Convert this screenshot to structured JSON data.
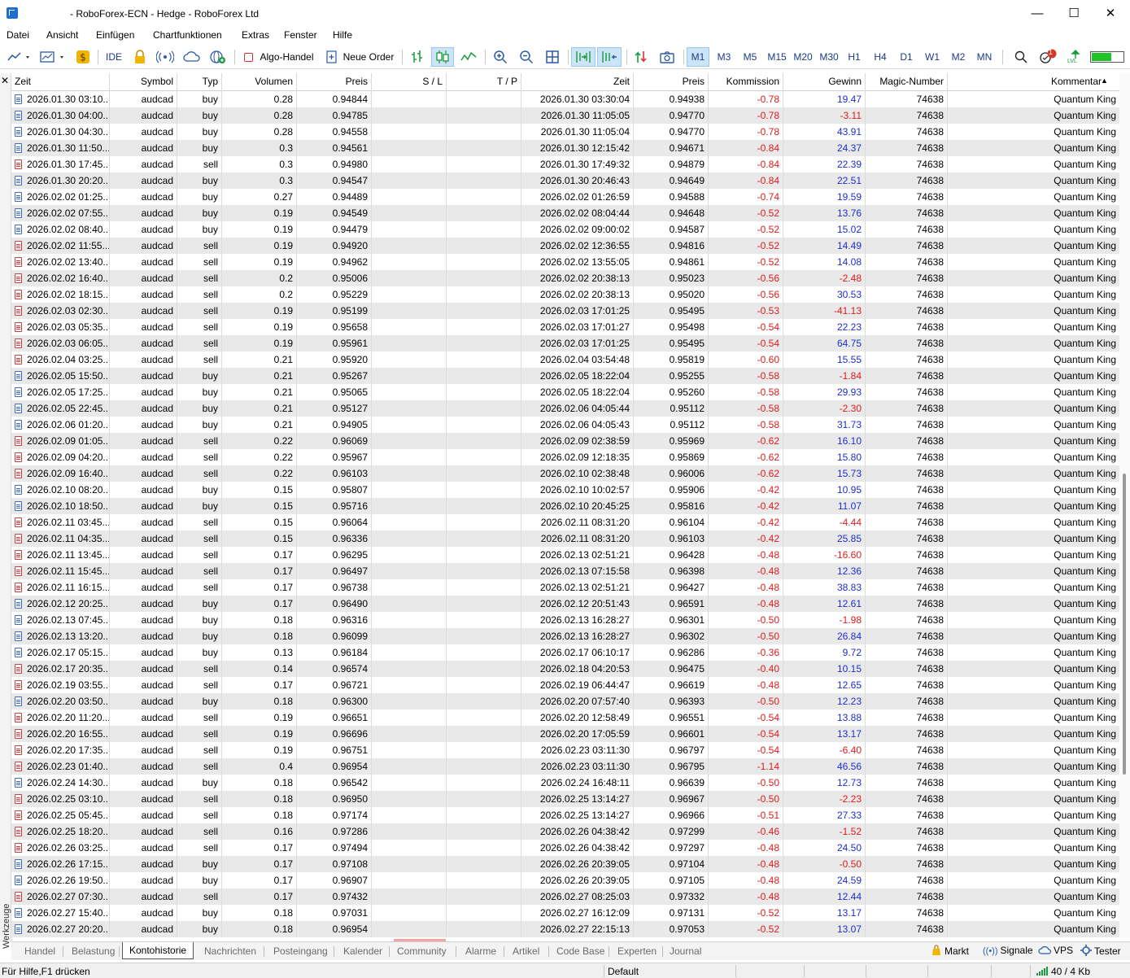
{
  "window": {
    "title": "- RoboForex-ECN - Hedge - RoboForex Ltd",
    "minimize": "—",
    "maximize": "☐",
    "close": "✕"
  },
  "menu": [
    "Datei",
    "Ansicht",
    "Einfügen",
    "Chartfunktionen",
    "Extras",
    "Fenster",
    "Hilfe"
  ],
  "toolbar": {
    "ide": "IDE",
    "algo": "Algo-Handel",
    "neue_order": "Neue Order",
    "timeframes": [
      "M1",
      "M3",
      "M5",
      "M15",
      "M20",
      "M30",
      "H1",
      "H4",
      "D1",
      "W1",
      "M2",
      "MN"
    ],
    "active_timeframe": "M1",
    "notifications": "1",
    "signal_label": "LVL"
  },
  "table": {
    "headers": {
      "zeit": "Zeit",
      "symbol": "Symbol",
      "typ": "Typ",
      "volumen": "Volumen",
      "preis": "Preis",
      "sl": "S / L",
      "tp": "T / P",
      "zeit2": "Zeit",
      "preis2": "Preis",
      "kommission": "Kommission",
      "gewinn": "Gewinn",
      "magic": "Magic-Number",
      "kommentar": "Kommentar"
    },
    "sort_indicator": "▲",
    "rows": [
      [
        "2026.01.30 03:10...",
        "audcad",
        "buy",
        "0.28",
        "0.94844",
        "",
        "",
        "2026.01.30 03:30:04",
        "0.94938",
        "-0.78",
        "19.47",
        "74638",
        "Quantum King"
      ],
      [
        "2026.01.30 04:00...",
        "audcad",
        "buy",
        "0.28",
        "0.94785",
        "",
        "",
        "2026.01.30 11:05:05",
        "0.94770",
        "-0.78",
        "-3.11",
        "74638",
        "Quantum King"
      ],
      [
        "2026.01.30 04:30...",
        "audcad",
        "buy",
        "0.28",
        "0.94558",
        "",
        "",
        "2026.01.30 11:05:04",
        "0.94770",
        "-0.78",
        "43.91",
        "74638",
        "Quantum King"
      ],
      [
        "2026.01.30 11:50...",
        "audcad",
        "buy",
        "0.3",
        "0.94561",
        "",
        "",
        "2026.01.30 12:15:42",
        "0.94671",
        "-0.84",
        "24.37",
        "74638",
        "Quantum King"
      ],
      [
        "2026.01.30 17:45...",
        "audcad",
        "sell",
        "0.3",
        "0.94980",
        "",
        "",
        "2026.01.30 17:49:32",
        "0.94879",
        "-0.84",
        "22.39",
        "74638",
        "Quantum King"
      ],
      [
        "2026.01.30 20:20...",
        "audcad",
        "buy",
        "0.3",
        "0.94547",
        "",
        "",
        "2026.01.30 20:46:43",
        "0.94649",
        "-0.84",
        "22.51",
        "74638",
        "Quantum King"
      ],
      [
        "2026.02.02 01:25...",
        "audcad",
        "buy",
        "0.27",
        "0.94489",
        "",
        "",
        "2026.02.02 01:26:59",
        "0.94588",
        "-0.74",
        "19.59",
        "74638",
        "Quantum King"
      ],
      [
        "2026.02.02 07:55...",
        "audcad",
        "buy",
        "0.19",
        "0.94549",
        "",
        "",
        "2026.02.02 08:04:44",
        "0.94648",
        "-0.52",
        "13.76",
        "74638",
        "Quantum King"
      ],
      [
        "2026.02.02 08:40...",
        "audcad",
        "buy",
        "0.19",
        "0.94479",
        "",
        "",
        "2026.02.02 09:00:02",
        "0.94587",
        "-0.52",
        "15.02",
        "74638",
        "Quantum King"
      ],
      [
        "2026.02.02 11:55...",
        "audcad",
        "sell",
        "0.19",
        "0.94920",
        "",
        "",
        "2026.02.02 12:36:55",
        "0.94816",
        "-0.52",
        "14.49",
        "74638",
        "Quantum King"
      ],
      [
        "2026.02.02 13:40...",
        "audcad",
        "sell",
        "0.19",
        "0.94962",
        "",
        "",
        "2026.02.02 13:55:05",
        "0.94861",
        "-0.52",
        "14.08",
        "74638",
        "Quantum King"
      ],
      [
        "2026.02.02 16:40...",
        "audcad",
        "sell",
        "0.2",
        "0.95006",
        "",
        "",
        "2026.02.02 20:38:13",
        "0.95023",
        "-0.56",
        "-2.48",
        "74638",
        "Quantum King"
      ],
      [
        "2026.02.02 18:15...",
        "audcad",
        "sell",
        "0.2",
        "0.95229",
        "",
        "",
        "2026.02.02 20:38:13",
        "0.95020",
        "-0.56",
        "30.53",
        "74638",
        "Quantum King"
      ],
      [
        "2026.02.03 02:30...",
        "audcad",
        "sell",
        "0.19",
        "0.95199",
        "",
        "",
        "2026.02.03 17:01:25",
        "0.95495",
        "-0.53",
        "-41.13",
        "74638",
        "Quantum King"
      ],
      [
        "2026.02.03 05:35...",
        "audcad",
        "sell",
        "0.19",
        "0.95658",
        "",
        "",
        "2026.02.03 17:01:27",
        "0.95498",
        "-0.54",
        "22.23",
        "74638",
        "Quantum King"
      ],
      [
        "2026.02.03 06:05...",
        "audcad",
        "sell",
        "0.19",
        "0.95961",
        "",
        "",
        "2026.02.03 17:01:25",
        "0.95495",
        "-0.54",
        "64.75",
        "74638",
        "Quantum King"
      ],
      [
        "2026.02.04 03:25...",
        "audcad",
        "sell",
        "0.21",
        "0.95920",
        "",
        "",
        "2026.02.04 03:54:48",
        "0.95819",
        "-0.60",
        "15.55",
        "74638",
        "Quantum King"
      ],
      [
        "2026.02.05 15:50...",
        "audcad",
        "buy",
        "0.21",
        "0.95267",
        "",
        "",
        "2026.02.05 18:22:04",
        "0.95255",
        "-0.58",
        "-1.84",
        "74638",
        "Quantum King"
      ],
      [
        "2026.02.05 17:25...",
        "audcad",
        "buy",
        "0.21",
        "0.95065",
        "",
        "",
        "2026.02.05 18:22:04",
        "0.95260",
        "-0.58",
        "29.93",
        "74638",
        "Quantum King"
      ],
      [
        "2026.02.05 22:45...",
        "audcad",
        "buy",
        "0.21",
        "0.95127",
        "",
        "",
        "2026.02.06 04:05:44",
        "0.95112",
        "-0.58",
        "-2.30",
        "74638",
        "Quantum King"
      ],
      [
        "2026.02.06 01:20...",
        "audcad",
        "buy",
        "0.21",
        "0.94905",
        "",
        "",
        "2026.02.06 04:05:43",
        "0.95112",
        "-0.58",
        "31.73",
        "74638",
        "Quantum King"
      ],
      [
        "2026.02.09 01:05...",
        "audcad",
        "sell",
        "0.22",
        "0.96069",
        "",
        "",
        "2026.02.09 02:38:59",
        "0.95969",
        "-0.62",
        "16.10",
        "74638",
        "Quantum King"
      ],
      [
        "2026.02.09 04:20...",
        "audcad",
        "sell",
        "0.22",
        "0.95967",
        "",
        "",
        "2026.02.09 12:18:35",
        "0.95869",
        "-0.62",
        "15.80",
        "74638",
        "Quantum King"
      ],
      [
        "2026.02.09 16:40...",
        "audcad",
        "sell",
        "0.22",
        "0.96103",
        "",
        "",
        "2026.02.10 02:38:48",
        "0.96006",
        "-0.62",
        "15.73",
        "74638",
        "Quantum King"
      ],
      [
        "2026.02.10 08:20...",
        "audcad",
        "buy",
        "0.15",
        "0.95807",
        "",
        "",
        "2026.02.10 10:02:57",
        "0.95906",
        "-0.42",
        "10.95",
        "74638",
        "Quantum King"
      ],
      [
        "2026.02.10 18:50...",
        "audcad",
        "buy",
        "0.15",
        "0.95716",
        "",
        "",
        "2026.02.10 20:45:25",
        "0.95816",
        "-0.42",
        "11.07",
        "74638",
        "Quantum King"
      ],
      [
        "2026.02.11 03:45...",
        "audcad",
        "sell",
        "0.15",
        "0.96064",
        "",
        "",
        "2026.02.11 08:31:20",
        "0.96104",
        "-0.42",
        "-4.44",
        "74638",
        "Quantum King"
      ],
      [
        "2026.02.11 04:35...",
        "audcad",
        "sell",
        "0.15",
        "0.96336",
        "",
        "",
        "2026.02.11 08:31:20",
        "0.96103",
        "-0.42",
        "25.85",
        "74638",
        "Quantum King"
      ],
      [
        "2026.02.11 13:45...",
        "audcad",
        "sell",
        "0.17",
        "0.96295",
        "",
        "",
        "2026.02.13 02:51:21",
        "0.96428",
        "-0.48",
        "-16.60",
        "74638",
        "Quantum King"
      ],
      [
        "2026.02.11 15:45...",
        "audcad",
        "sell",
        "0.17",
        "0.96497",
        "",
        "",
        "2026.02.13 07:15:58",
        "0.96398",
        "-0.48",
        "12.36",
        "74638",
        "Quantum King"
      ],
      [
        "2026.02.11 16:15...",
        "audcad",
        "sell",
        "0.17",
        "0.96738",
        "",
        "",
        "2026.02.13 02:51:21",
        "0.96427",
        "-0.48",
        "38.83",
        "74638",
        "Quantum King"
      ],
      [
        "2026.02.12 20:25...",
        "audcad",
        "buy",
        "0.17",
        "0.96490",
        "",
        "",
        "2026.02.12 20:51:43",
        "0.96591",
        "-0.48",
        "12.61",
        "74638",
        "Quantum King"
      ],
      [
        "2026.02.13 07:45...",
        "audcad",
        "buy",
        "0.18",
        "0.96316",
        "",
        "",
        "2026.02.13 16:28:27",
        "0.96301",
        "-0.50",
        "-1.98",
        "74638",
        "Quantum King"
      ],
      [
        "2026.02.13 13:20...",
        "audcad",
        "buy",
        "0.18",
        "0.96099",
        "",
        "",
        "2026.02.13 16:28:27",
        "0.96302",
        "-0.50",
        "26.84",
        "74638",
        "Quantum King"
      ],
      [
        "2026.02.17 05:15...",
        "audcad",
        "buy",
        "0.13",
        "0.96184",
        "",
        "",
        "2026.02.17 06:10:17",
        "0.96286",
        "-0.36",
        "9.72",
        "74638",
        "Quantum King"
      ],
      [
        "2026.02.17 20:35...",
        "audcad",
        "sell",
        "0.14",
        "0.96574",
        "",
        "",
        "2026.02.18 04:20:53",
        "0.96475",
        "-0.40",
        "10.15",
        "74638",
        "Quantum King"
      ],
      [
        "2026.02.19 03:55...",
        "audcad",
        "sell",
        "0.17",
        "0.96721",
        "",
        "",
        "2026.02.19 06:44:47",
        "0.96619",
        "-0.48",
        "12.65",
        "74638",
        "Quantum King"
      ],
      [
        "2026.02.20 03:50...",
        "audcad",
        "buy",
        "0.18",
        "0.96300",
        "",
        "",
        "2026.02.20 07:57:40",
        "0.96393",
        "-0.50",
        "12.23",
        "74638",
        "Quantum King"
      ],
      [
        "2026.02.20 11:20...",
        "audcad",
        "sell",
        "0.19",
        "0.96651",
        "",
        "",
        "2026.02.20 12:58:49",
        "0.96551",
        "-0.54",
        "13.88",
        "74638",
        "Quantum King"
      ],
      [
        "2026.02.20 16:55...",
        "audcad",
        "sell",
        "0.19",
        "0.96696",
        "",
        "",
        "2026.02.20 17:05:59",
        "0.96601",
        "-0.54",
        "13.17",
        "74638",
        "Quantum King"
      ],
      [
        "2026.02.20 17:35...",
        "audcad",
        "sell",
        "0.19",
        "0.96751",
        "",
        "",
        "2026.02.23 03:11:30",
        "0.96797",
        "-0.54",
        "-6.40",
        "74638",
        "Quantum King"
      ],
      [
        "2026.02.23 01:40...",
        "audcad",
        "sell",
        "0.4",
        "0.96954",
        "",
        "",
        "2026.02.23 03:11:30",
        "0.96795",
        "-1.14",
        "46.56",
        "74638",
        "Quantum King"
      ],
      [
        "2026.02.24 14:30...",
        "audcad",
        "buy",
        "0.18",
        "0.96542",
        "",
        "",
        "2026.02.24 16:48:11",
        "0.96639",
        "-0.50",
        "12.73",
        "74638",
        "Quantum King"
      ],
      [
        "2026.02.25 03:10...",
        "audcad",
        "sell",
        "0.18",
        "0.96950",
        "",
        "",
        "2026.02.25 13:14:27",
        "0.96967",
        "-0.50",
        "-2.23",
        "74638",
        "Quantum King"
      ],
      [
        "2026.02.25 05:45...",
        "audcad",
        "sell",
        "0.18",
        "0.97174",
        "",
        "",
        "2026.02.25 13:14:27",
        "0.96966",
        "-0.51",
        "27.33",
        "74638",
        "Quantum King"
      ],
      [
        "2026.02.25 18:20...",
        "audcad",
        "sell",
        "0.16",
        "0.97286",
        "",
        "",
        "2026.02.26 04:38:42",
        "0.97299",
        "-0.46",
        "-1.52",
        "74638",
        "Quantum King"
      ],
      [
        "2026.02.26 03:25...",
        "audcad",
        "sell",
        "0.17",
        "0.97494",
        "",
        "",
        "2026.02.26 04:38:42",
        "0.97297",
        "-0.48",
        "24.50",
        "74638",
        "Quantum King"
      ],
      [
        "2026.02.26 17:15...",
        "audcad",
        "buy",
        "0.17",
        "0.97108",
        "",
        "",
        "2026.02.26 20:39:05",
        "0.97104",
        "-0.48",
        "-0.50",
        "74638",
        "Quantum King"
      ],
      [
        "2026.02.26 19:50...",
        "audcad",
        "buy",
        "0.17",
        "0.96907",
        "",
        "",
        "2026.02.26 20:39:05",
        "0.97105",
        "-0.48",
        "24.59",
        "74638",
        "Quantum King"
      ],
      [
        "2026.02.27 07:30...",
        "audcad",
        "sell",
        "0.17",
        "0.97432",
        "",
        "",
        "2026.02.27 08:25:03",
        "0.97332",
        "-0.48",
        "12.44",
        "74638",
        "Quantum King"
      ],
      [
        "2026.02.27 15:40...",
        "audcad",
        "buy",
        "0.18",
        "0.97031",
        "",
        "",
        "2026.02.27 16:12:09",
        "0.97131",
        "-0.52",
        "13.17",
        "74638",
        "Quantum King"
      ],
      [
        "2026.02.27 20:20...",
        "audcad",
        "buy",
        "0.18",
        "0.96954",
        "",
        "",
        "2026.02.27 22:15:13",
        "0.97053",
        "-0.52",
        "13.07",
        "74638",
        "Quantum King"
      ]
    ]
  },
  "bottom_tabs": [
    "Handel",
    "Belastung",
    "Kontohistorie",
    "Nachrichten",
    "Posteingang",
    "Kalender",
    "Community",
    "Alarme",
    "Artikel",
    "Code Base",
    "Experten",
    "Journal"
  ],
  "active_tab": "Kontohistorie",
  "bottom_right": {
    "markt": "Markt",
    "signale": "Signale",
    "vps": "VPS",
    "tester": "Tester"
  },
  "side_label": "Werkzeuge",
  "status": {
    "help": "Für Hilfe,F1 drücken",
    "profile": "Default",
    "traffic": "40 / 4 Kb"
  },
  "colors": {
    "negative": "#e01b1b",
    "positive": "#1a2fd0",
    "active_tf": "#cce4f7",
    "tab_accent": "#f3a4a4"
  }
}
